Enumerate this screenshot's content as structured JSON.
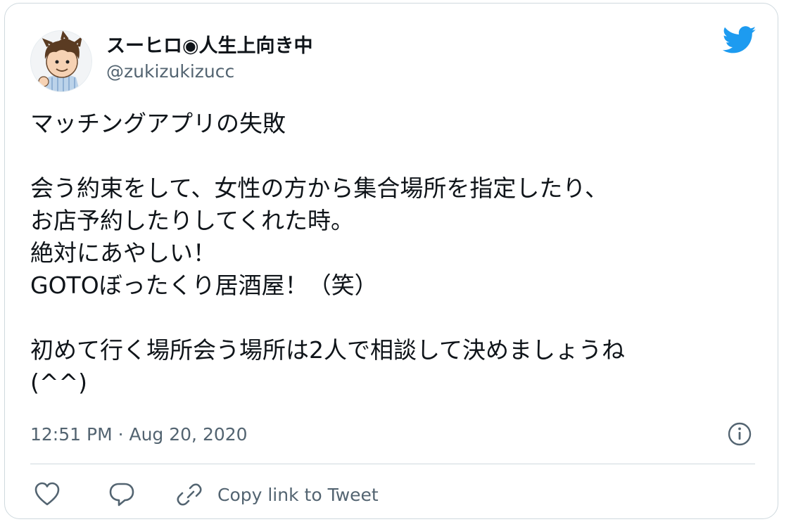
{
  "tweet": {
    "author": {
      "display_name": "スーヒロ◉人生上向き中",
      "handle": "@zukizukizucc"
    },
    "text_lines": [
      "マッチングアプリの失敗",
      "",
      "会う約束をして、女性の方から集合場所を指定したり、",
      "お店予約したりしてくれた時。",
      "絶対にあやしい！",
      "GOTOぼったくり居酒屋！（笑）",
      "",
      "初めて行く場所会う場所は2人で相談して決めましょうね",
      "(^^)"
    ],
    "timestamp": "12:51 PM · Aug 20, 2020"
  },
  "actions": {
    "copy_link_label": "Copy link to Tweet"
  },
  "icons": {
    "brand": "twitter-bird-icon",
    "info": "info-icon",
    "like": "heart-icon",
    "reply": "reply-bubble-icon",
    "link": "link-chain-icon"
  },
  "colors": {
    "brand_blue": "#1d9bf0",
    "text_primary": "#0f1419",
    "text_secondary": "#536471",
    "border": "#cfd9de"
  }
}
